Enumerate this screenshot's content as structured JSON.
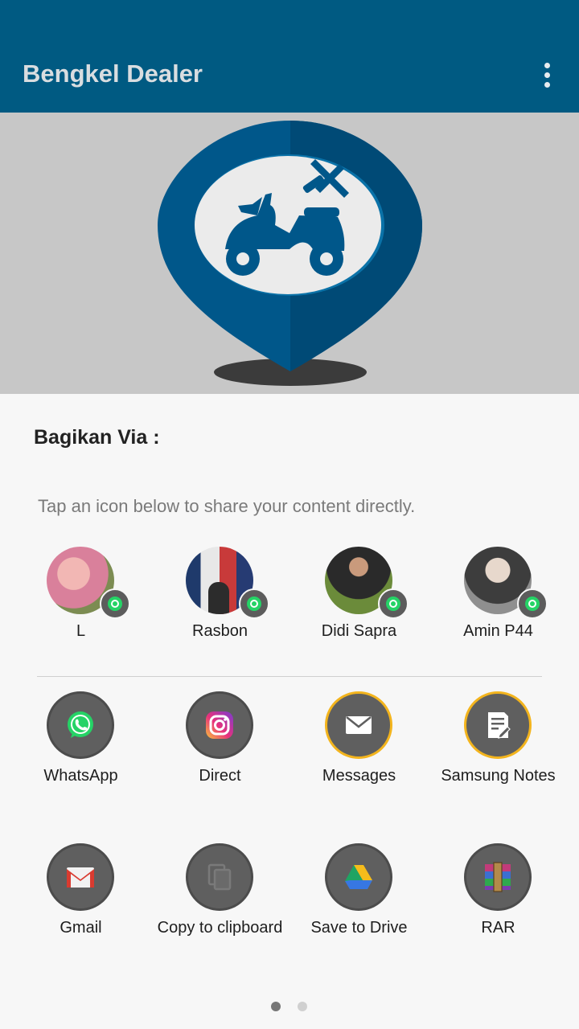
{
  "appbar": {
    "title": "Bengkel Dealer",
    "overflow_icon": "more-vert-icon"
  },
  "colors": {
    "primary": "#005a82",
    "logo_blue": "#00578a",
    "hero_bg": "#c7c7c7",
    "whatsapp_green": "#25d366",
    "accent_gold": "#f3b41d"
  },
  "share_sheet": {
    "title": "Bagikan Via :",
    "subtitle": "Tap an icon below to share your content directly.",
    "contacts": [
      {
        "name": "L",
        "app": "whatsapp"
      },
      {
        "name": "Rasbon",
        "app": "whatsapp"
      },
      {
        "name": "Didi Sapra",
        "app": "whatsapp"
      },
      {
        "name": "Amin P44",
        "app": "whatsapp"
      }
    ],
    "apps_row1": [
      {
        "label": "WhatsApp",
        "icon": "whatsapp-icon"
      },
      {
        "label": "Direct",
        "icon": "instagram-icon"
      },
      {
        "label": "Messages",
        "icon": "envelope-icon"
      },
      {
        "label": "Samsung Notes",
        "icon": "notes-icon"
      }
    ],
    "apps_row2": [
      {
        "label": "Gmail",
        "icon": "gmail-icon"
      },
      {
        "label": "Copy to clipboard",
        "icon": "copy-icon"
      },
      {
        "label": "Save to Drive",
        "icon": "drive-icon"
      },
      {
        "label": "RAR",
        "icon": "rar-icon"
      }
    ],
    "pager": {
      "pages": 2,
      "current": 1
    }
  }
}
